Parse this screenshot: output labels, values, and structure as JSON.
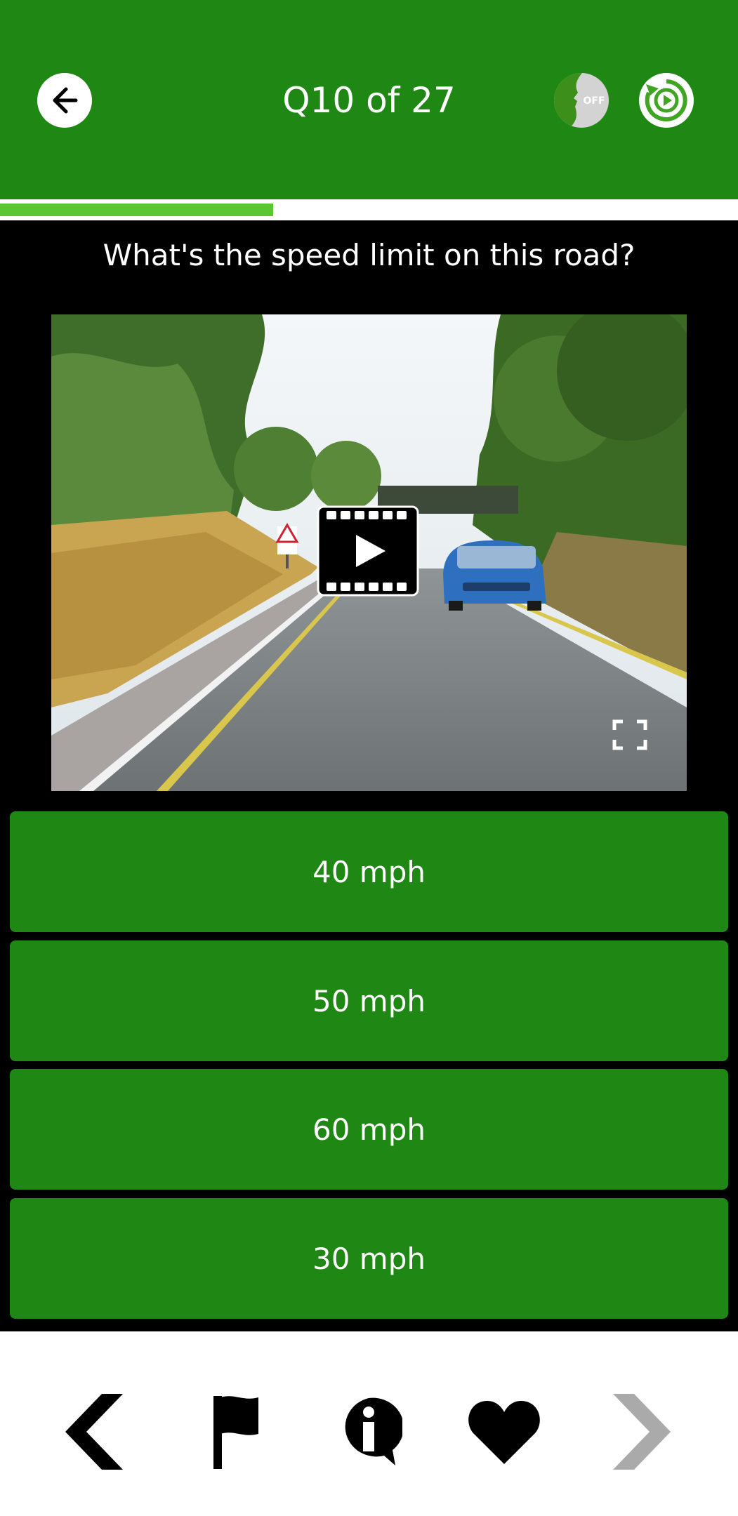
{
  "header": {
    "title": "Q10 of 27",
    "back_icon": "arrow-left-icon",
    "voice_toggle": {
      "icon": "voice-head-icon",
      "state_label": "OFF"
    },
    "replay_icon": "replay-video-icon"
  },
  "progress": {
    "current": 10,
    "total": 27,
    "fraction": 0.37
  },
  "question": {
    "text": "What's the speed limit on this road?",
    "media": {
      "type": "video",
      "play_icon": "play-film-icon",
      "fullscreen_icon": "fullscreen-icon"
    }
  },
  "answers": [
    {
      "label": "40 mph"
    },
    {
      "label": "50 mph"
    },
    {
      "label": "60 mph"
    },
    {
      "label": "30 mph"
    }
  ],
  "footer": {
    "items": [
      {
        "icon": "chevron-left-icon"
      },
      {
        "icon": "flag-icon"
      },
      {
        "icon": "info-icon"
      },
      {
        "icon": "heart-icon"
      },
      {
        "icon": "chevron-right-icon",
        "disabled": true
      }
    ]
  },
  "colors": {
    "header_green": "#1f8714",
    "progress_green": "#5cc632",
    "answer_green": "#1f8714",
    "disabled_grey": "#aaaaaa"
  }
}
